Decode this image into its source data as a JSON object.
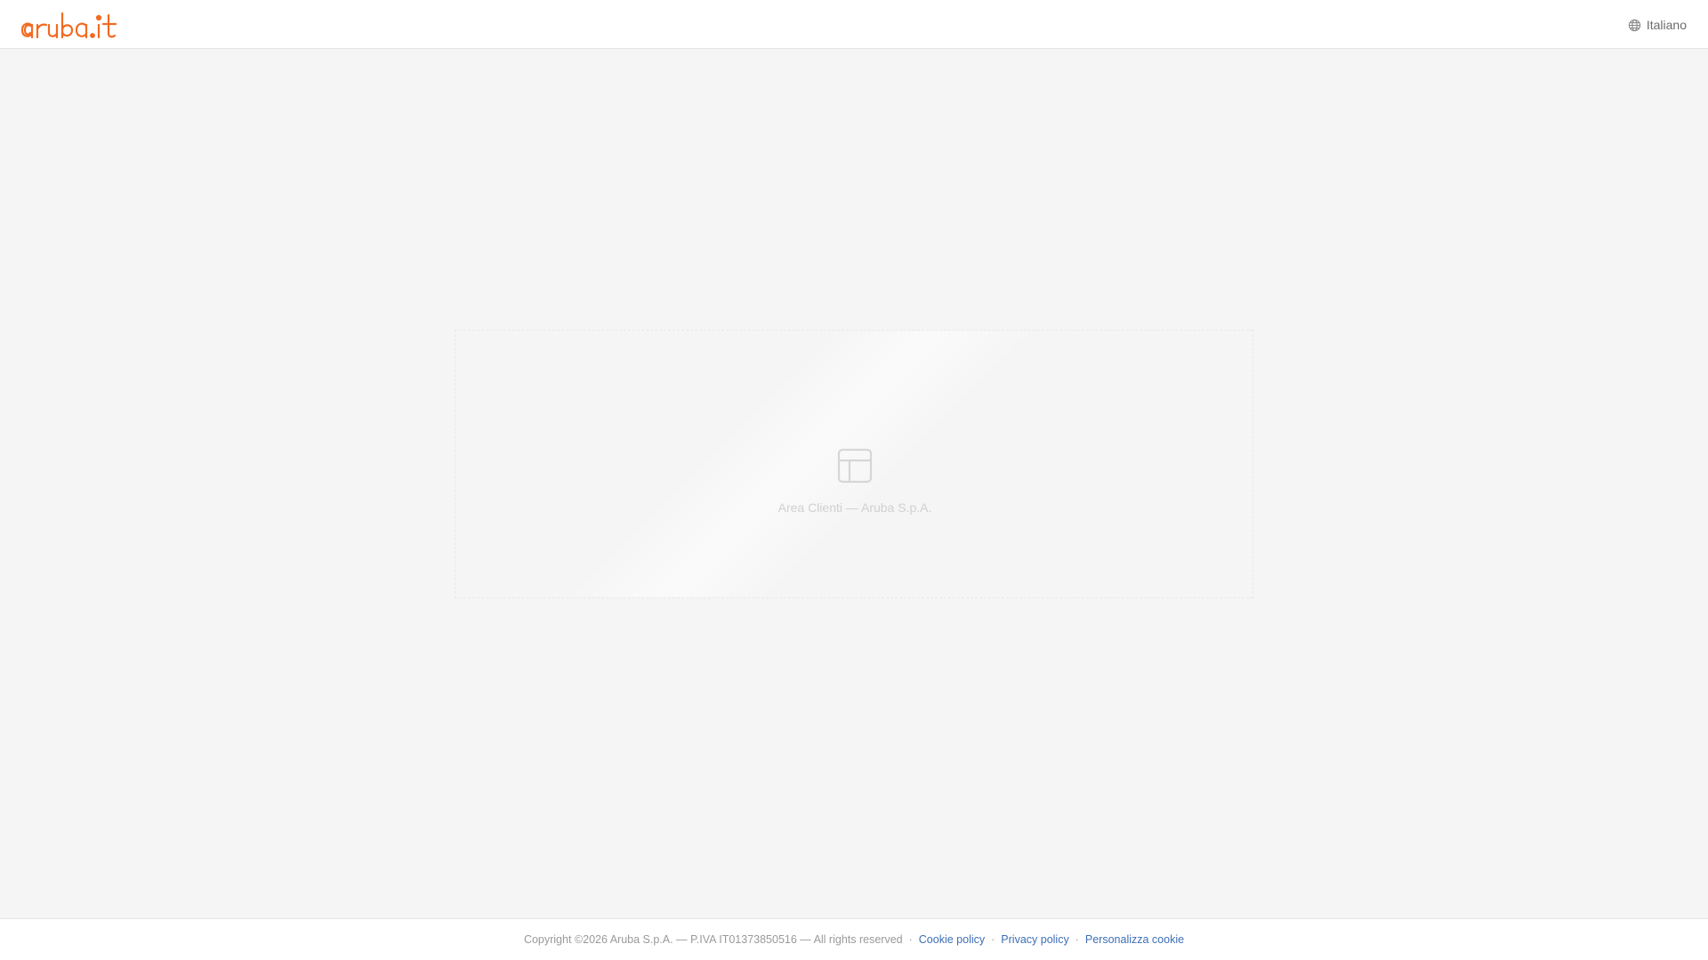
{
  "header": {
    "logo_text": "aruba.it",
    "language": {
      "label": "Italiano",
      "icon": "globe-icon"
    }
  },
  "main": {
    "placeholder": {
      "icon": "layout-icon",
      "caption": "Area Clienti — Aruba S.p.A."
    }
  },
  "footer": {
    "copyright": "Copyright ©2026 Aruba S.p.A. — P.IVA IT01373850516 — All rights reserved",
    "separator": "·",
    "links": {
      "cookie_policy": "Cookie policy",
      "privacy_policy": "Privacy policy",
      "cookie_settings": "Personalizza cookie"
    }
  },
  "colors": {
    "brand": "#f26a21",
    "link": "#3d6fb6",
    "background": "#f5f5f5"
  }
}
